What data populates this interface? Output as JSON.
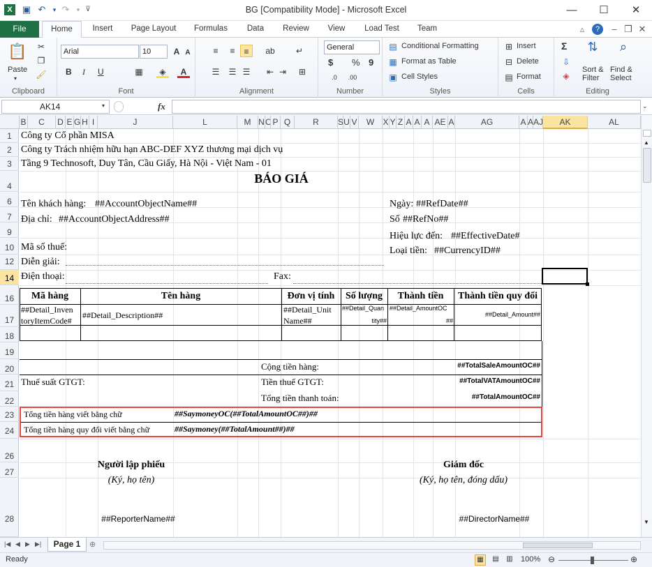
{
  "window": {
    "title": "BG  [Compatibility Mode]  -  Microsoft Excel"
  },
  "tabs": {
    "file": "File",
    "home": "Home",
    "insert": "Insert",
    "page_layout": "Page Layout",
    "formulas": "Formulas",
    "data": "Data",
    "review": "Review",
    "view": "View",
    "load_test": "Load Test",
    "team": "Team"
  },
  "ribbon": {
    "clipboard": {
      "label": "Clipboard",
      "paste": "Paste"
    },
    "font": {
      "label": "Font",
      "name": "Arial",
      "size": "10",
      "bold": "B",
      "italic": "I",
      "underline": "U"
    },
    "alignment": {
      "label": "Alignment"
    },
    "number": {
      "label": "Number",
      "format": "General",
      "currency": "$",
      "percent": "%",
      "comma": "9"
    },
    "styles": {
      "label": "Styles",
      "conditional": "Conditional Formatting",
      "format_table": "Format as Table",
      "cell_styles": "Cell Styles"
    },
    "cells": {
      "label": "Cells",
      "insert": "Insert",
      "delete": "Delete",
      "format": "Format"
    },
    "editing": {
      "label": "Editing",
      "sum": "Σ",
      "sort": "Sort &",
      "filter": "Filter",
      "find": "Find &",
      "select": "Select"
    }
  },
  "formula_bar": {
    "name_box": "AK14",
    "fx": "fx",
    "value": ""
  },
  "columns": [
    "B",
    "C",
    "D",
    "E",
    "G",
    "H",
    "I",
    "J",
    "L",
    "M",
    "N",
    "O",
    "P",
    "Q",
    "R",
    "S",
    "U",
    "V",
    "W",
    "X",
    "Y",
    "Z",
    "A",
    "A",
    "A",
    "AE",
    "A",
    "AG",
    "A",
    "A",
    "AJ",
    "AK",
    "AL"
  ],
  "rows": [
    "1",
    "2",
    "3",
    "4",
    "6",
    "7",
    "9",
    "10",
    "12",
    "14",
    "16",
    "17",
    "18",
    "19",
    "20",
    "21",
    "22",
    "23",
    "24",
    "26",
    "27",
    "28"
  ],
  "sheet": {
    "company": "Công ty Cổ phần MISA",
    "company2": "Công ty Trách nhiệm hữu hạn ABC-DEF XYZ thương mại dịch vụ",
    "address": "Tầng 9 Technosoft, Duy Tân, Cầu Giấy, Hà Nội - Việt Nam - 01",
    "title": "BÁO GIÁ",
    "customer_label": "Tên khách hàng:",
    "customer_val": "##AccountObjectName##",
    "address_label": "Địa chỉ:",
    "address_val": "##AccountObjectAddress##",
    "date_label": "Ngày:",
    "date_val": "##RefDate##",
    "no_label": "Số",
    "no_val": "##RefNo##",
    "effective_label": "Hiệu lực đến:",
    "effective_val": "##EffectiveDate#",
    "currency_label": "Loại tiền:",
    "currency_val": "##CurrencyID##",
    "tax_label": "Mã số thuế:",
    "desc_label": "Diễn giải:",
    "phone_label": "Điện thoại:",
    "fax_label": "Fax:",
    "table_headers": [
      "Mã hàng",
      "Tên hàng",
      "Đơn vị tính",
      "Số lượng",
      "Thành tiền",
      "Thành tiền quy đổi"
    ],
    "detail_code": [
      "##Detail_Inven",
      "toryItemCode#"
    ],
    "detail_desc": "##Detail_Description##",
    "detail_unit": [
      "##Detail_Unit",
      "Name##"
    ],
    "detail_qty": [
      "##Detail_Quan",
      "tity##"
    ],
    "detail_amountoc": [
      "##Detail_AmountOC",
      "##"
    ],
    "detail_amount": "##Detail_Amount##",
    "total_label": "Cộng tiền hàng:",
    "total_val": "##TotalSaleAmountOC##",
    "vat_rate_label": "Thuế suất GTGT:",
    "vat_label": "Tiền thuế GTGT:",
    "vat_val": "##TotalVATAmountOC##",
    "grand_label": "Tổng tiền thanh toán:",
    "grand_val": "##TotalAmountOC##",
    "words_label": "Tổng tiền hàng viết bằng chữ",
    "words_val": "##SaymoneyOC(##TotalAmountOC##)##",
    "words2_label": "Tổng tiền hàng quy đổi viết bằng chữ",
    "words2_val": "##Saymoney(##TotalAmount##)##",
    "preparer": "Người lập phiếu",
    "preparer_sign": "(Ký, họ tên)",
    "director": "Giám đốc",
    "director_sign": "(Ký, họ tên, đóng dấu)",
    "reporter": "##ReporterName##",
    "director_name": "##DirectorName##"
  },
  "sheet_tab": "Page 1",
  "status": {
    "ready": "Ready",
    "zoom": "100%"
  },
  "colors": {
    "accent": "#1e7145",
    "highlight": "#e8443a"
  }
}
